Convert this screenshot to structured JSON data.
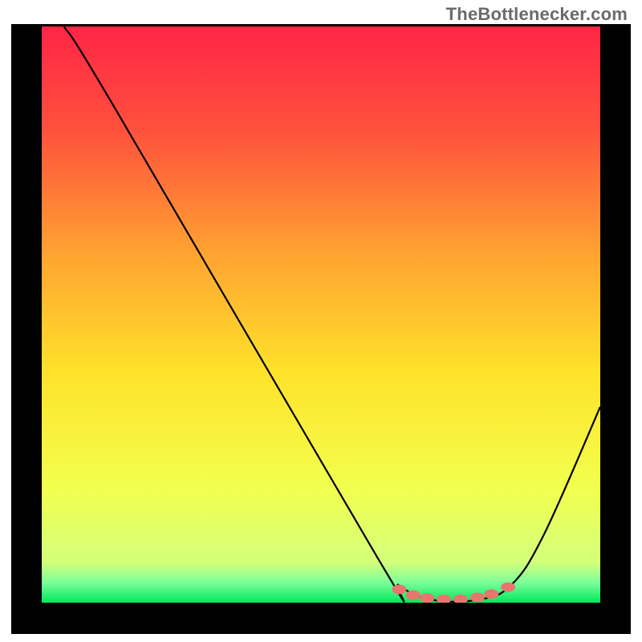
{
  "watermark": "TheBottlenecker.com",
  "chart_data": {
    "type": "line",
    "title": "",
    "xlabel": "",
    "ylabel": "",
    "xlim": [
      0,
      100
    ],
    "ylim": [
      0,
      100
    ],
    "gradient_stops": [
      {
        "offset": 0,
        "color": "#ff2546"
      },
      {
        "offset": 18,
        "color": "#ff513d"
      },
      {
        "offset": 40,
        "color": "#ffa531"
      },
      {
        "offset": 60,
        "color": "#ffe22a"
      },
      {
        "offset": 80,
        "color": "#f2ff4e"
      },
      {
        "offset": 93,
        "color": "#d4ff7a"
      },
      {
        "offset": 96.5,
        "color": "#7bff9a"
      },
      {
        "offset": 100,
        "color": "#00e85c"
      }
    ],
    "series": [
      {
        "name": "curve",
        "color": "#000000",
        "points": [
          {
            "x": 4,
            "y": 100
          },
          {
            "x": 13,
            "y": 86
          },
          {
            "x": 60,
            "y": 8
          },
          {
            "x": 64,
            "y": 3
          },
          {
            "x": 70,
            "y": 0.5
          },
          {
            "x": 78,
            "y": 0.5
          },
          {
            "x": 84,
            "y": 3
          },
          {
            "x": 90,
            "y": 12
          },
          {
            "x": 100,
            "y": 34
          }
        ]
      }
    ],
    "markers": [
      {
        "x": 64,
        "y": 2.3
      },
      {
        "x": 66.5,
        "y": 1.3
      },
      {
        "x": 69,
        "y": 0.8
      },
      {
        "x": 72,
        "y": 0.6
      },
      {
        "x": 75,
        "y": 0.6
      },
      {
        "x": 78,
        "y": 0.9
      },
      {
        "x": 80.5,
        "y": 1.5
      },
      {
        "x": 83.5,
        "y": 2.7
      }
    ],
    "marker_style": {
      "color": "#e8766e"
    }
  }
}
